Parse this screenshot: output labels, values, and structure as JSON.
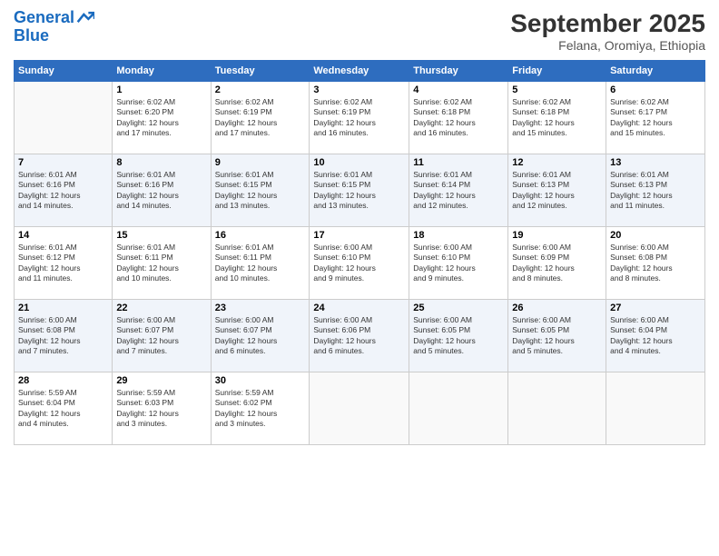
{
  "logo": {
    "line1": "General",
    "line2": "Blue"
  },
  "title": "September 2025",
  "location": "Felana, Oromiya, Ethiopia",
  "days_of_week": [
    "Sunday",
    "Monday",
    "Tuesday",
    "Wednesday",
    "Thursday",
    "Friday",
    "Saturday"
  ],
  "weeks": [
    [
      {
        "day": "",
        "info": ""
      },
      {
        "day": "1",
        "info": "Sunrise: 6:02 AM\nSunset: 6:20 PM\nDaylight: 12 hours\nand 17 minutes."
      },
      {
        "day": "2",
        "info": "Sunrise: 6:02 AM\nSunset: 6:19 PM\nDaylight: 12 hours\nand 17 minutes."
      },
      {
        "day": "3",
        "info": "Sunrise: 6:02 AM\nSunset: 6:19 PM\nDaylight: 12 hours\nand 16 minutes."
      },
      {
        "day": "4",
        "info": "Sunrise: 6:02 AM\nSunset: 6:18 PM\nDaylight: 12 hours\nand 16 minutes."
      },
      {
        "day": "5",
        "info": "Sunrise: 6:02 AM\nSunset: 6:18 PM\nDaylight: 12 hours\nand 15 minutes."
      },
      {
        "day": "6",
        "info": "Sunrise: 6:02 AM\nSunset: 6:17 PM\nDaylight: 12 hours\nand 15 minutes."
      }
    ],
    [
      {
        "day": "7",
        "info": "Sunrise: 6:01 AM\nSunset: 6:16 PM\nDaylight: 12 hours\nand 14 minutes."
      },
      {
        "day": "8",
        "info": "Sunrise: 6:01 AM\nSunset: 6:16 PM\nDaylight: 12 hours\nand 14 minutes."
      },
      {
        "day": "9",
        "info": "Sunrise: 6:01 AM\nSunset: 6:15 PM\nDaylight: 12 hours\nand 13 minutes."
      },
      {
        "day": "10",
        "info": "Sunrise: 6:01 AM\nSunset: 6:15 PM\nDaylight: 12 hours\nand 13 minutes."
      },
      {
        "day": "11",
        "info": "Sunrise: 6:01 AM\nSunset: 6:14 PM\nDaylight: 12 hours\nand 12 minutes."
      },
      {
        "day": "12",
        "info": "Sunrise: 6:01 AM\nSunset: 6:13 PM\nDaylight: 12 hours\nand 12 minutes."
      },
      {
        "day": "13",
        "info": "Sunrise: 6:01 AM\nSunset: 6:13 PM\nDaylight: 12 hours\nand 11 minutes."
      }
    ],
    [
      {
        "day": "14",
        "info": "Sunrise: 6:01 AM\nSunset: 6:12 PM\nDaylight: 12 hours\nand 11 minutes."
      },
      {
        "day": "15",
        "info": "Sunrise: 6:01 AM\nSunset: 6:11 PM\nDaylight: 12 hours\nand 10 minutes."
      },
      {
        "day": "16",
        "info": "Sunrise: 6:01 AM\nSunset: 6:11 PM\nDaylight: 12 hours\nand 10 minutes."
      },
      {
        "day": "17",
        "info": "Sunrise: 6:00 AM\nSunset: 6:10 PM\nDaylight: 12 hours\nand 9 minutes."
      },
      {
        "day": "18",
        "info": "Sunrise: 6:00 AM\nSunset: 6:10 PM\nDaylight: 12 hours\nand 9 minutes."
      },
      {
        "day": "19",
        "info": "Sunrise: 6:00 AM\nSunset: 6:09 PM\nDaylight: 12 hours\nand 8 minutes."
      },
      {
        "day": "20",
        "info": "Sunrise: 6:00 AM\nSunset: 6:08 PM\nDaylight: 12 hours\nand 8 minutes."
      }
    ],
    [
      {
        "day": "21",
        "info": "Sunrise: 6:00 AM\nSunset: 6:08 PM\nDaylight: 12 hours\nand 7 minutes."
      },
      {
        "day": "22",
        "info": "Sunrise: 6:00 AM\nSunset: 6:07 PM\nDaylight: 12 hours\nand 7 minutes."
      },
      {
        "day": "23",
        "info": "Sunrise: 6:00 AM\nSunset: 6:07 PM\nDaylight: 12 hours\nand 6 minutes."
      },
      {
        "day": "24",
        "info": "Sunrise: 6:00 AM\nSunset: 6:06 PM\nDaylight: 12 hours\nand 6 minutes."
      },
      {
        "day": "25",
        "info": "Sunrise: 6:00 AM\nSunset: 6:05 PM\nDaylight: 12 hours\nand 5 minutes."
      },
      {
        "day": "26",
        "info": "Sunrise: 6:00 AM\nSunset: 6:05 PM\nDaylight: 12 hours\nand 5 minutes."
      },
      {
        "day": "27",
        "info": "Sunrise: 6:00 AM\nSunset: 6:04 PM\nDaylight: 12 hours\nand 4 minutes."
      }
    ],
    [
      {
        "day": "28",
        "info": "Sunrise: 5:59 AM\nSunset: 6:04 PM\nDaylight: 12 hours\nand 4 minutes."
      },
      {
        "day": "29",
        "info": "Sunrise: 5:59 AM\nSunset: 6:03 PM\nDaylight: 12 hours\nand 3 minutes."
      },
      {
        "day": "30",
        "info": "Sunrise: 5:59 AM\nSunset: 6:02 PM\nDaylight: 12 hours\nand 3 minutes."
      },
      {
        "day": "",
        "info": ""
      },
      {
        "day": "",
        "info": ""
      },
      {
        "day": "",
        "info": ""
      },
      {
        "day": "",
        "info": ""
      }
    ]
  ]
}
